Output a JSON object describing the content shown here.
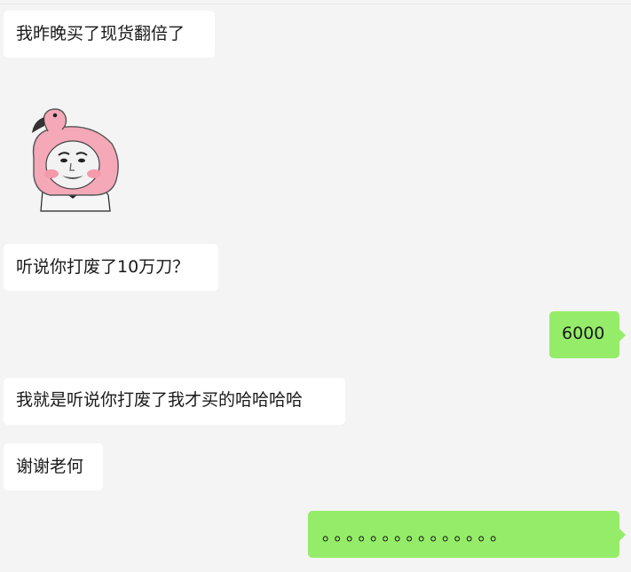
{
  "chat": {
    "messages": [
      {
        "direction": "incoming",
        "type": "text",
        "text": "我昨晚买了现货翻倍了"
      },
      {
        "direction": "incoming",
        "type": "sticker",
        "sticker_icon": "flamingo-hat-meme-face-icon"
      },
      {
        "direction": "incoming",
        "type": "text",
        "text": "听说你打废了10万刀？"
      },
      {
        "direction": "outgoing",
        "type": "text",
        "text": "6000"
      },
      {
        "direction": "incoming",
        "type": "text",
        "text": "我就是听说你打废了我才买的哈哈哈哈"
      },
      {
        "direction": "incoming",
        "type": "text",
        "text": "谢谢老何"
      },
      {
        "direction": "outgoing",
        "type": "text",
        "text": "。。。。。。。。。。。。。。。"
      }
    ]
  },
  "colors": {
    "background": "#f4f4f4",
    "incoming_bubble": "#ffffff",
    "outgoing_bubble": "#95ec69"
  }
}
